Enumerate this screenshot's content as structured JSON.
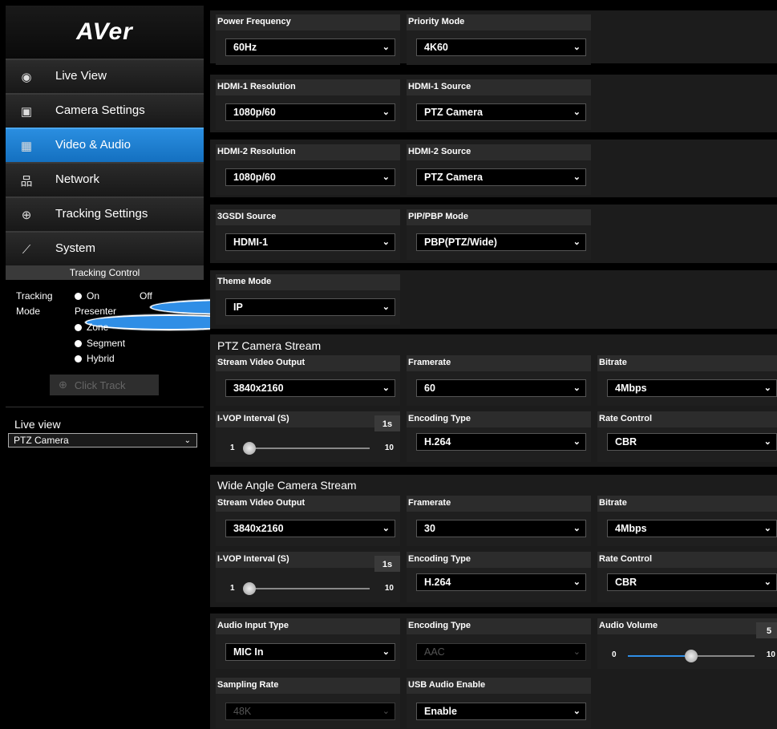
{
  "brand": "AVer",
  "nav": [
    {
      "label": "Live View",
      "icon": "eye-icon",
      "glyph": "◉",
      "active": false
    },
    {
      "label": "Camera Settings",
      "icon": "image-icon",
      "glyph": "▣",
      "active": false
    },
    {
      "label": "Video & Audio",
      "icon": "video-audio-icon",
      "glyph": "▦",
      "active": true
    },
    {
      "label": "Network",
      "icon": "network-icon",
      "glyph": "品",
      "active": false
    },
    {
      "label": "Tracking Settings",
      "icon": "target-icon",
      "glyph": "⊕",
      "active": false
    },
    {
      "label": "System",
      "icon": "pulse-icon",
      "glyph": "⟋",
      "active": false
    }
  ],
  "tracking_control": {
    "title": "Tracking Control",
    "mode_label_1": "Tracking",
    "mode_label_2": "Mode",
    "on": "On",
    "off": "Off",
    "options": [
      "Presenter",
      "Zone",
      "Segment",
      "Hybrid"
    ],
    "click_track": "Click Track"
  },
  "live_view": {
    "title": "Live view",
    "selected": "PTZ Camera"
  },
  "general": {
    "power_frequency": {
      "label": "Power Frequency",
      "value": "60Hz"
    },
    "priority_mode": {
      "label": "Priority Mode",
      "value": "4K60"
    },
    "hdmi1_res": {
      "label": "HDMI-1 Resolution",
      "value": "1080p/60"
    },
    "hdmi1_src": {
      "label": "HDMI-1 Source",
      "value": "PTZ Camera"
    },
    "hdmi2_res": {
      "label": "HDMI-2 Resolution",
      "value": "1080p/60"
    },
    "hdmi2_src": {
      "label": "HDMI-2 Source",
      "value": "PTZ Camera"
    },
    "sdi_src": {
      "label": "3GSDI Source",
      "value": "HDMI-1"
    },
    "pip_mode": {
      "label": "PIP/PBP Mode",
      "value": "PBP(PTZ/Wide)"
    },
    "theme": {
      "label": "Theme Mode",
      "value": "IP"
    }
  },
  "ptz": {
    "title": "PTZ Camera Stream",
    "output": {
      "label": "Stream Video Output",
      "value": "3840x2160"
    },
    "framerate": {
      "label": "Framerate",
      "value": "60"
    },
    "bitrate": {
      "label": "Bitrate",
      "value": "4Mbps"
    },
    "ivop": {
      "label": "I-VOP Interval (S)",
      "value": "1s",
      "min": "1",
      "max": "10",
      "level": 0.0
    },
    "encoding": {
      "label": "Encoding Type",
      "value": "H.264"
    },
    "rate": {
      "label": "Rate Control",
      "value": "CBR"
    }
  },
  "wide": {
    "title": "Wide Angle Camera Stream",
    "output": {
      "label": "Stream Video Output",
      "value": "3840x2160"
    },
    "framerate": {
      "label": "Framerate",
      "value": "30"
    },
    "bitrate": {
      "label": "Bitrate",
      "value": "4Mbps"
    },
    "ivop": {
      "label": "I-VOP Interval (S)",
      "value": "1s",
      "min": "1",
      "max": "10",
      "level": 0.0
    },
    "encoding": {
      "label": "Encoding Type",
      "value": "H.264"
    },
    "rate": {
      "label": "Rate Control",
      "value": "CBR"
    }
  },
  "audio": {
    "input": {
      "label": "Audio Input Type",
      "value": "MIC In"
    },
    "encoding": {
      "label": "Encoding Type",
      "value": "AAC"
    },
    "volume": {
      "label": "Audio Volume",
      "value": "5",
      "min": "0",
      "max": "10",
      "level": 0.5
    },
    "sampling": {
      "label": "Sampling Rate",
      "value": "48K"
    },
    "usb": {
      "label": "USB Audio Enable",
      "value": "Enable"
    }
  }
}
